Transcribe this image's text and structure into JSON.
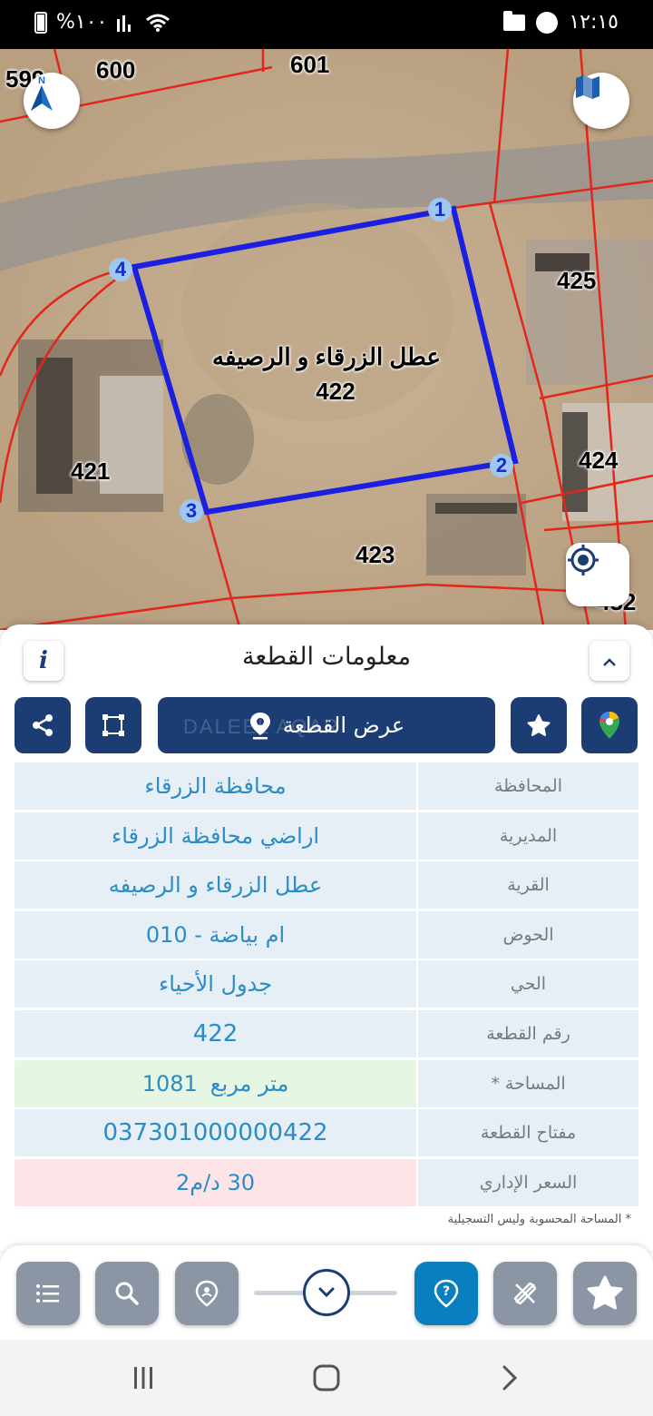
{
  "status_bar": {
    "battery_text": "%١٠٠",
    "time": "١٢:١٥",
    "icons": [
      "battery-icon",
      "signal-icon",
      "wifi-icon",
      "folder-icon",
      "messenger-icon"
    ]
  },
  "map": {
    "parcel_labels": {
      "p599": "599",
      "p600": "600",
      "p601": "601",
      "p425": "425",
      "p424": "424",
      "p421": "421",
      "p423": "423",
      "p432": "432"
    },
    "selected_parcel": {
      "village": "عطل الزرقاء و الرصيفه",
      "number": "422",
      "vertices": [
        "1",
        "2",
        "3",
        "4"
      ]
    },
    "compass_label": "N",
    "colors": {
      "boundary": "#e3261b",
      "selected": "#1b1fe0"
    }
  },
  "sheet": {
    "title": "معلومات القطعة",
    "show_parcel_label": "عرض القطعة",
    "watermark": "DALEEL AQAR",
    "rows": [
      {
        "key": "المحافظة",
        "value": "محافظة الزرقاء"
      },
      {
        "key": "المديرية",
        "value": "اراضي محافظة الزرقاء"
      },
      {
        "key": "القرية",
        "value": "عطل الزرقاء و الرصيفه"
      },
      {
        "key": "الحوض",
        "value": "ام بياضة - 010"
      },
      {
        "key": "الحي",
        "value": "جدول الأحياء"
      },
      {
        "key": "رقم القطعة",
        "value": "422"
      },
      {
        "key": "المساحة *",
        "value_number": "1081",
        "value_unit": "متر مربع"
      },
      {
        "key": "مفتاح القطعة",
        "value": "037301000000422"
      },
      {
        "key": "السعر الإداري",
        "value": "30 د/م2"
      }
    ],
    "footnote": "* المساحة المحسوبة وليس التسجيلية",
    "colors": {
      "accent": "#1c3d73",
      "value_text": "#2b8dc4",
      "row_bg": "#e6eef6",
      "area_bg": "#e5f6e4",
      "price_bg": "#fde4e6"
    }
  },
  "toolbar": {
    "active_color": "#0a7fc0",
    "inactive_color": "#8b95a3"
  }
}
